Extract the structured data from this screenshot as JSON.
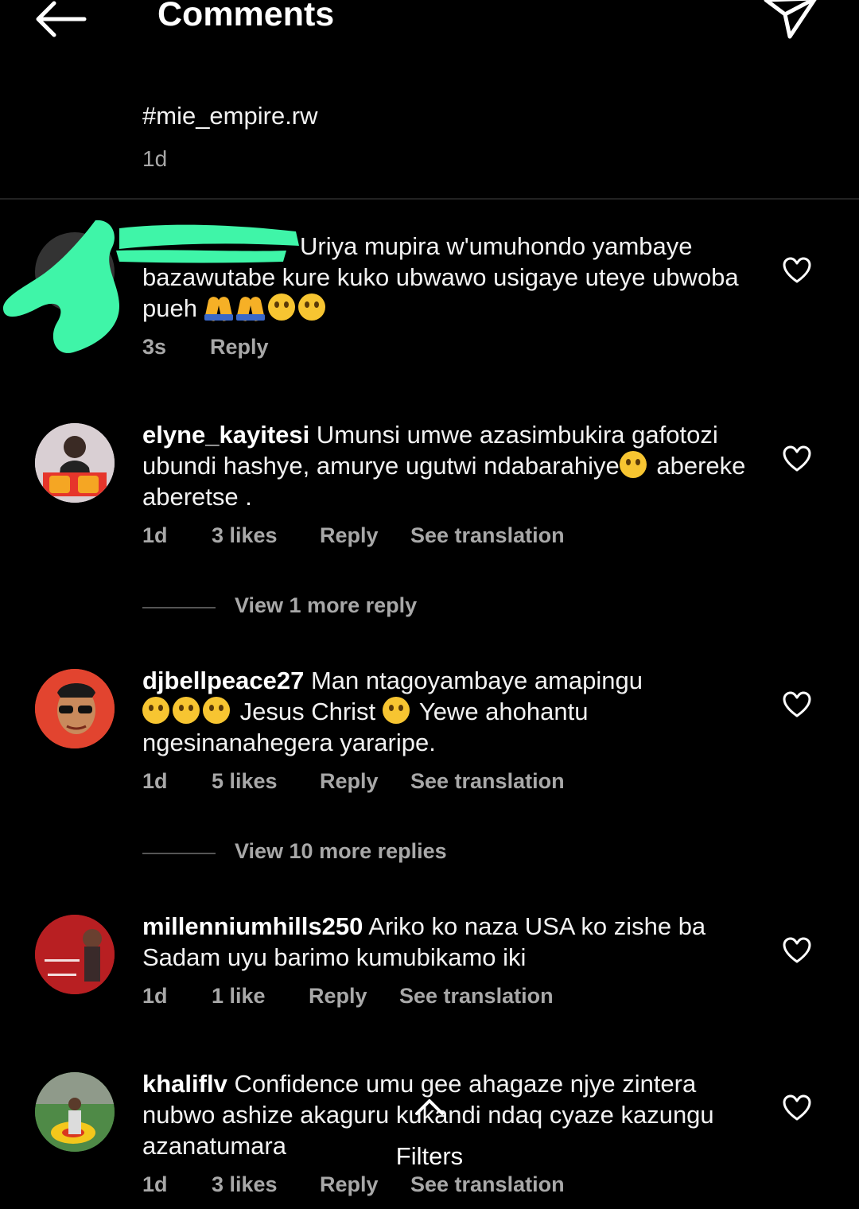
{
  "header": {
    "title": "Comments",
    "back_icon": "arrow-left-icon",
    "send_icon": "paper-plane-icon"
  },
  "caption": {
    "text": "#mie_empire.rw",
    "time": "1d"
  },
  "comments": [
    {
      "username": "",
      "text": "Uriya mupira w'umuhondo yambaye bazawutabe kure kuko ubwawo usigaye uteye ubwoba pueh",
      "time": "3s",
      "reply": "Reply"
    },
    {
      "username": "elyne_kayitesi",
      "text_a": "Umunsi umwe azasimbukira gafotozi ubundi hashye, amurye ugutwi ndabarahiye",
      "text_b": "abereke aberetse .",
      "time": "1d",
      "likes": "3 likes",
      "reply": "Reply",
      "translation": "See translation",
      "view_replies": "View 1 more reply"
    },
    {
      "username": "djbellpeace27",
      "text_a": "Man ntagoyambaye amapingu",
      "text_b": "Jesus Christ",
      "text_c": "Yewe ahohantu ngesinanahegera yararipe.",
      "time": "1d",
      "likes": "5 likes",
      "reply": "Reply",
      "translation": "See translation",
      "view_replies": "View 10 more replies"
    },
    {
      "username": "millenniumhills250",
      "text": "Ariko ko naza USA ko zishe ba Sadam uyu barimo kumubikamo iki",
      "time": "1d",
      "likes": "1 like",
      "reply": "Reply",
      "translation": "See translation"
    },
    {
      "username": "khaliflv",
      "text": "Confidence umu gee ahagaze njye zintera nubwo ashize akaguru kukandi ndaq cyaze kazungu azanatumara",
      "time": "1d",
      "likes": "3 likes",
      "reply": "Reply",
      "translation": "See translation"
    }
  ],
  "filters": {
    "label": "Filters"
  },
  "colors": {
    "background": "#000000",
    "text": "#f2f2f2",
    "muted": "#a8a8a8",
    "scribble": "#3ff5a8"
  }
}
